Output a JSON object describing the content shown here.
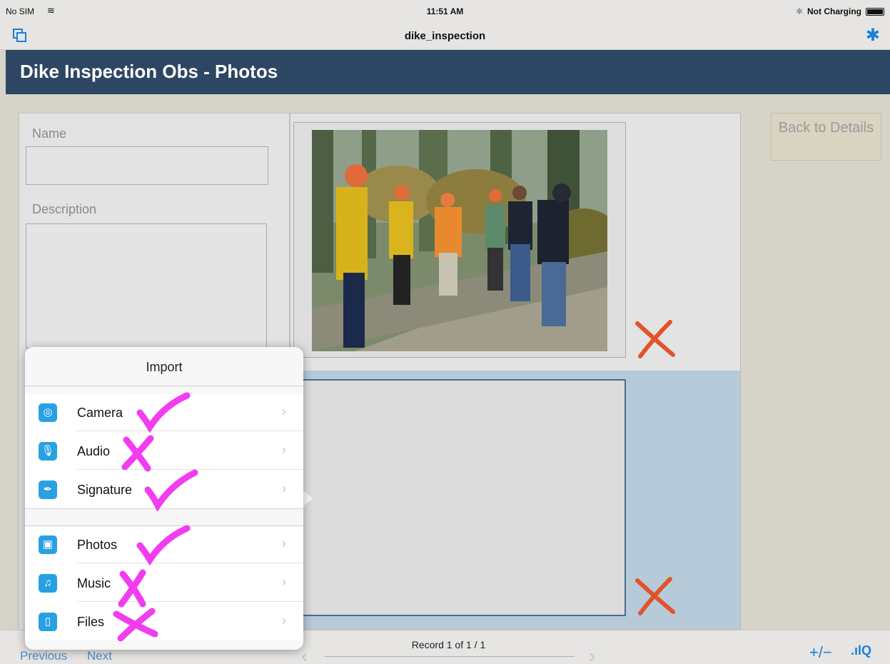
{
  "status_bar": {
    "carrier": "No SIM",
    "time": "11:51 AM",
    "battery_text": "Not Charging"
  },
  "toolbar": {
    "document_title": "dike_inspection",
    "left_icon": "layouts-icon",
    "right_icon": "gear-icon"
  },
  "header": {
    "title": "Dike Inspection Obs - Photos"
  },
  "form": {
    "name_label": "Name",
    "name_value": "",
    "description_label": "Description",
    "description_value": ""
  },
  "portal": {
    "rows": [
      {
        "has_photo": true,
        "delete_icon": "red-x-icon"
      },
      {
        "has_photo": false,
        "delete_icon": "red-x-icon"
      }
    ]
  },
  "right_panel": {
    "back_button": "Back to Details"
  },
  "bottom_bar": {
    "previous": "Previous",
    "next": "Next",
    "record_text": "Record 1 of 1 / 1",
    "addremove_icon": "+/−",
    "chart_icon": ".ılQ"
  },
  "import_popover": {
    "title": "Import",
    "groups": [
      {
        "items": [
          {
            "label": "Camera",
            "icon": "camera-icon",
            "glyph": "◎",
            "annotation": "check"
          },
          {
            "label": "Audio",
            "icon": "microphone-icon",
            "glyph": "🎙",
            "annotation": "cross"
          },
          {
            "label": "Signature",
            "icon": "pen-icon",
            "glyph": "✒",
            "annotation": "check"
          }
        ]
      },
      {
        "items": [
          {
            "label": "Photos",
            "icon": "photos-icon",
            "glyph": "▣",
            "annotation": "check"
          },
          {
            "label": "Music",
            "icon": "music-note-icon",
            "glyph": "♫",
            "annotation": "cross"
          },
          {
            "label": "Files",
            "icon": "file-icon",
            "glyph": "▯",
            "annotation": "cross"
          }
        ]
      }
    ]
  },
  "colors": {
    "header_bg": "#2c4663",
    "accent_blue": "#1c7fd8",
    "delete_red": "#e2532a",
    "annotation_magenta": "#f23cf0",
    "portal_selected_bg": "#b7cad9"
  }
}
